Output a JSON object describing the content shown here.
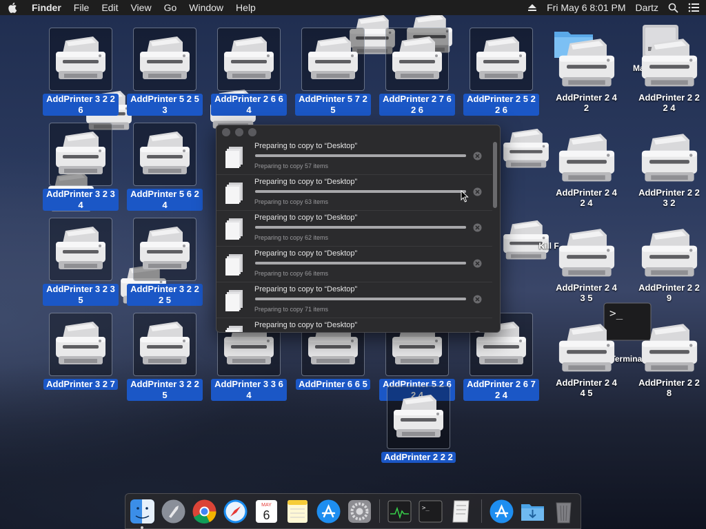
{
  "menubar": {
    "app_name": "Finder",
    "menus": [
      "File",
      "Edit",
      "View",
      "Go",
      "Window",
      "Help"
    ],
    "datetime": "Fri May 6  8:01 PM",
    "user": "Dartz"
  },
  "desktop": {
    "icons": [
      {
        "label": "AddPrinter 3 2 2 6"
      },
      {
        "label": "AddPrinter 5 2 5 3"
      },
      {
        "label": "AddPrinter 2 6 6 4"
      },
      {
        "label": "AddPrinter 5 7 2 5"
      },
      {
        "label": "AddPrinter 2 7 6 2 6"
      },
      {
        "label": "AddPrinter 2 5 2 2 6"
      },
      {
        "label": "AddPrinter 3 2 3 4"
      },
      {
        "label": "AddPrinter 5 6 2 4"
      },
      {
        "label": "AddPrinter 3 2 3 5"
      },
      {
        "label": "AddPrinter 3 2 2 2 5"
      },
      {
        "label": "AddPrinter 3 2 7"
      },
      {
        "label": "AddPrinter 3 2 2 5"
      },
      {
        "label": "AddPrinter 3 3 6 4"
      },
      {
        "label": "AddPrinter 6 6 5"
      },
      {
        "label": "AddPrinter 5 2 6 2 4"
      },
      {
        "label": "AddPrinter 2 6 7 2 4"
      },
      {
        "label": "AddPrinter 2 2 2"
      }
    ],
    "right_icons": [
      {
        "label": "AddPrinter 2 4 2"
      },
      {
        "label": "AddPrinter 2 2 2 4"
      },
      {
        "label": "AddPrinter 2 4 2 4"
      },
      {
        "label": "AddPrinter 2 2 3 2"
      },
      {
        "label": "AddPrinter 2 4 3 5"
      },
      {
        "label": "AddPrinter 2 2 9"
      },
      {
        "label": "AddPrinter 2 4 4 5"
      },
      {
        "label": "AddPrinter 2 2 8"
      }
    ],
    "apps": [
      {
        "label": "Macintosh HD"
      },
      {
        "label": "Kill F"
      },
      {
        "label": "Terminal"
      }
    ]
  },
  "copy_window": {
    "items": [
      {
        "title": "Preparing to copy to “Desktop”",
        "subtitle": "Preparing to copy 57 items",
        "progress": 1.0
      },
      {
        "title": "Preparing to copy to “Desktop”",
        "subtitle": "Preparing to copy 63 items",
        "progress": 1.0
      },
      {
        "title": "Preparing to copy to “Desktop”",
        "subtitle": "Preparing to copy 62 items",
        "progress": 1.0
      },
      {
        "title": "Preparing to copy to “Desktop”",
        "subtitle": "Preparing to copy 66 items",
        "progress": 1.0
      },
      {
        "title": "Preparing to copy to “Desktop”",
        "subtitle": "Preparing to copy 71 items",
        "progress": 1.0
      },
      {
        "title": "Preparing to copy to “Desktop”",
        "subtitle": "",
        "progress": 1.0
      }
    ]
  },
  "dock": {
    "items": [
      "finder-icon",
      "launchpad-icon",
      "chrome-icon",
      "safari-icon",
      "calendar-icon",
      "notes-icon",
      "app-store-icon",
      "system-preferences-icon",
      "activity-monitor-icon",
      "terminal-icon",
      "script-editor-icon",
      "app-store-downloads-icon",
      "downloads-folder-icon",
      "trash-icon"
    ],
    "calendar_month": "MAY",
    "calendar_day": "6"
  }
}
